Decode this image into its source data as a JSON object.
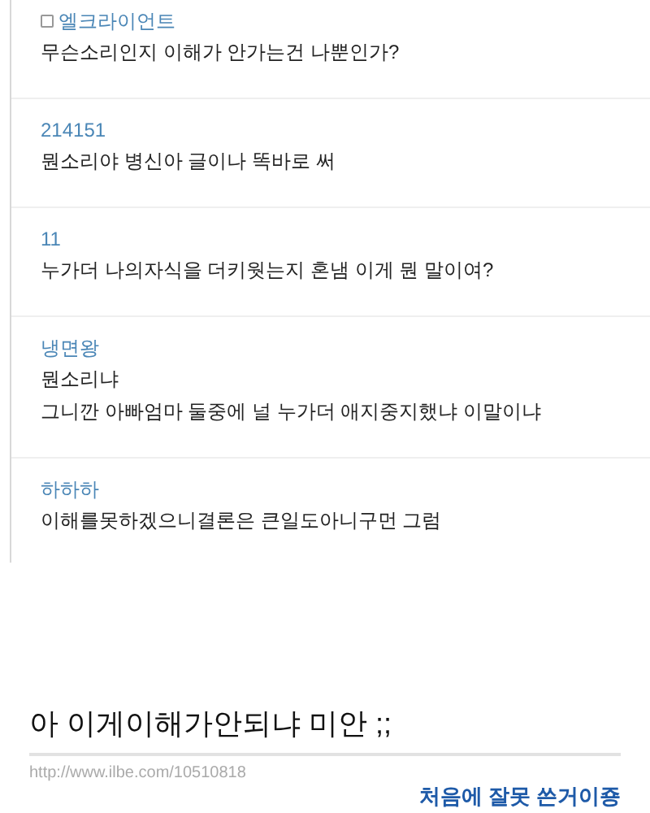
{
  "comments": [
    {
      "author": "엘크라이언트",
      "icon": true,
      "lines": [
        "무슨소리인지 이해가 안가는건 나뿐인가?"
      ]
    },
    {
      "author": "214151",
      "icon": false,
      "lines": [
        "뭔소리야 병신아 글이나 똑바로 써"
      ]
    },
    {
      "author": "11",
      "icon": false,
      "lines": [
        "누가더 나의자식을 더키웟는지 혼냄 이게 뭔 말이여?"
      ]
    },
    {
      "author": "냉면왕",
      "icon": false,
      "lines": [
        "뭔소리냐",
        "그니깐 아빠엄마 둘중에 널 누가더 애지중지했냐 이말이냐"
      ]
    },
    {
      "author": "하하하",
      "icon": false,
      "lines": [
        "이해를못하겠으니결론은 큰일도아니구먼 그럼"
      ]
    }
  ],
  "caption": {
    "title": "아 이게이해가안되냐 미안 ;;",
    "source_url": "http://www.ilbe.com/10510818",
    "note": "처음에 잘못 쓴거이죵"
  }
}
